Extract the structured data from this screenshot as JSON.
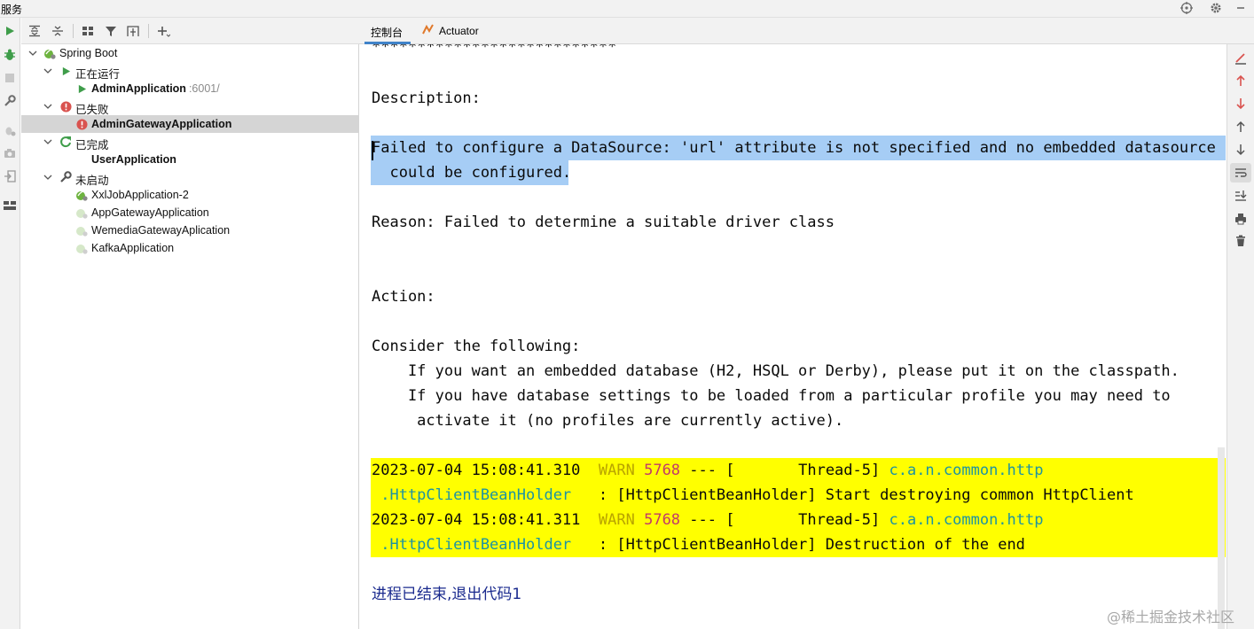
{
  "window": {
    "title": "服务"
  },
  "icons": {
    "title_bar": [
      "crosshair-icon",
      "gear-icon",
      "minimize-icon"
    ],
    "left_toolbar": [
      "run-icon",
      "debug-icon",
      "stop-icon",
      "wrench-icon",
      "bug-settings-icon",
      "camera-icon",
      "export-icon",
      "layout-icon"
    ],
    "tree_toolbar": [
      "expand-all-icon",
      "collapse-all-icon",
      "group-icon",
      "filter-icon",
      "new-service-icon",
      "add-icon"
    ],
    "console_toolbar": [
      "clear-icon",
      "prev-error-icon",
      "next-error-icon",
      "scroll-up-icon",
      "scroll-down-icon",
      "soft-wrap-icon",
      "scroll-to-end-icon",
      "print-icon",
      "trash-icon"
    ]
  },
  "tree": {
    "root": {
      "label": "Spring Boot"
    },
    "groups": [
      {
        "label": "正在运行",
        "status": "running",
        "items": [
          {
            "label": "AdminApplication",
            "port": ":6001/",
            "bold": true
          }
        ]
      },
      {
        "label": "已失败",
        "status": "failed",
        "items": [
          {
            "label": "AdminGatewayApplication",
            "bold": true,
            "selected": true
          }
        ]
      },
      {
        "label": "已完成",
        "status": "finished",
        "items": [
          {
            "label": "UserApplication",
            "bold": true
          }
        ]
      },
      {
        "label": "未启动",
        "status": "not-started",
        "items": [
          {
            "label": "XxlJobApplication-2"
          },
          {
            "label": "AppGatewayApplication"
          },
          {
            "label": "WemediaGatewayAplication"
          },
          {
            "label": "KafkaApplication"
          }
        ]
      }
    ]
  },
  "tabs": [
    {
      "label": "控制台",
      "active": true
    },
    {
      "label": "Actuator",
      "active": false
    }
  ],
  "console": {
    "stars": "***************************",
    "description_header": "Description:",
    "error_line1": "Failed to configure a DataSource: 'url' attribute is not specified and no embedded datasource",
    "error_line2": "  could be configured.",
    "reason": "Reason: Failed to determine a suitable driver class",
    "action_header": "Action:",
    "consider": "Consider the following:",
    "tip1": "    If you want an embedded database (H2, HSQL or Derby), please put it on the classpath.",
    "tip2a": "    If you have database settings to be loaded from a particular profile you may need to",
    "tip2b": "     activate it (no profiles are currently active).",
    "logs": [
      {
        "timestamp": "2023-07-04 15:08:41.310",
        "level": "WARN",
        "pid": "5768",
        "thread": "--- [       Thread-5]",
        "logger1": "c.a.n.common.http",
        "logger2": " .HttpClientBeanHolder",
        "message": "   : [HttpClientBeanHolder] Start destroying common HttpClient"
      },
      {
        "timestamp": "2023-07-04 15:08:41.311",
        "level": "WARN",
        "pid": "5768",
        "thread": "--- [       Thread-5]",
        "logger1": "c.a.n.common.http",
        "logger2": " .HttpClientBeanHolder",
        "message": "   : [HttpClientBeanHolder] Destruction of the end"
      }
    ],
    "exit_message": "进程已结束,退出代码1"
  },
  "watermark": "@稀土掘金技术社区",
  "colors": {
    "selection": "#a6cdf5",
    "highlight_yellow": "#ffff00",
    "warn": "#b9a400",
    "pid": "#c23a69",
    "logger": "#1c93a3",
    "exit": "#1a2a8e",
    "run_green": "#3f9d4a",
    "error_red": "#d9534f"
  }
}
